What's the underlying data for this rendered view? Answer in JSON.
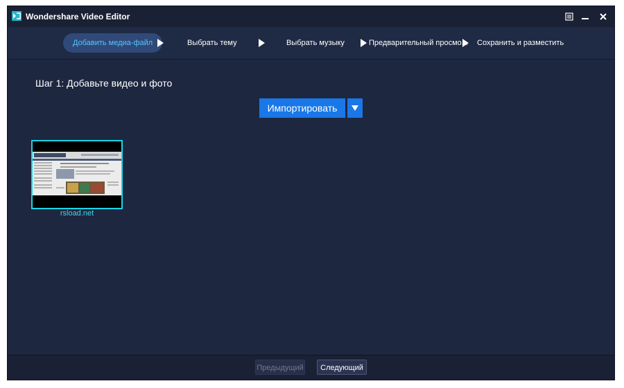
{
  "app": {
    "title": "Wondershare Video Editor"
  },
  "window_controls": {
    "menu_icon": "menu-icon",
    "minimize_icon": "minimize-icon",
    "close_icon": "close-icon"
  },
  "steps": [
    {
      "label": "Добавить медиа-файл",
      "active": true
    },
    {
      "label": "Выбрать тему",
      "active": false
    },
    {
      "label": "Выбрать музыку",
      "active": false
    },
    {
      "label": "Предварительный просмо...",
      "active": false
    },
    {
      "label": "Сохранить и разместить",
      "active": false
    }
  ],
  "main": {
    "heading": "Шаг 1: Добавьте видео и фото",
    "import_label": "Импортировать"
  },
  "media": [
    {
      "caption": "rsload.net",
      "selected": true
    }
  ],
  "footer": {
    "prev_label": "Предыдущий",
    "next_label": "Следующий"
  },
  "colors": {
    "accent": "#1a77e8",
    "selection": "#18d6e6",
    "active_step_text": "#59c4ff",
    "background": "#1e2740"
  }
}
